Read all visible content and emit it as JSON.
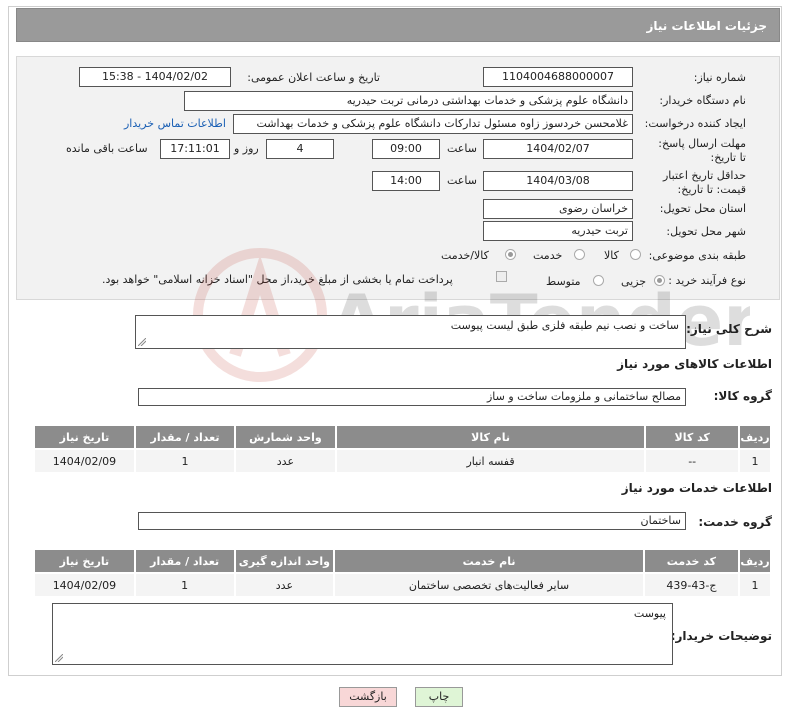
{
  "header": {
    "title": "جزئیات اطلاعات نیاز"
  },
  "form": {
    "need_number_label": "شماره نیاز:",
    "need_number": "1104004688000007",
    "announce_label": "تاریخ و ساعت اعلان عمومی:",
    "announce_value": "1404/02/02 - 15:38",
    "buyer_org_label": "نام دستگاه خریدار:",
    "buyer_org": "دانشگاه علوم پزشکی و خدمات بهداشتی درمانی تربت حیدریه",
    "creator_label": "ایجاد کننده درخواست:",
    "creator": "غلامحسن خردسوز زاوه مسئول تدارکات دانشگاه علوم پزشکی و خدمات بهداشت",
    "contact_link": "اطلاعات تماس خریدار",
    "deadline_label": "مهلت ارسال پاسخ: تا تاریخ:",
    "deadline_date": "1404/02/07",
    "time_label": "ساعت",
    "deadline_time": "09:00",
    "days_value": "4",
    "days_label": "روز و",
    "remaining_time": "17:11:01",
    "remaining_label": "ساعت باقی مانده",
    "validity_label": "حداقل تاریخ اعتبار قیمت: تا تاریخ:",
    "validity_date": "1404/03/08",
    "validity_time": "14:00",
    "province_label": "استان محل تحویل:",
    "province": "خراسان رضوی",
    "city_label": "شهر محل تحویل:",
    "city": "تربت حیدریه",
    "category_label": "طبقه بندی موضوعی:",
    "category_options": [
      "کالا",
      "خدمت",
      "کالا/خدمت"
    ],
    "process_label": "نوع فرآیند خرید :",
    "process_options": [
      "جزیی",
      "متوسط"
    ],
    "payment_note": "پرداخت تمام یا بخشی از مبلغ خرید،از محل \"اسناد خزانه اسلامی\" خواهد بود."
  },
  "description": {
    "label": "شرح کلی نیاز:",
    "value": "ساخت و نصب نیم طبقه فلزی طبق لیست پیوست"
  },
  "goods": {
    "section_title": "اطلاعات کالاهای مورد نیاز",
    "group_label": "گروه کالا:",
    "group_value": "مصالح ساختمانی و ملزومات ساخت و ساز",
    "headers": [
      "ردیف",
      "کد کالا",
      "نام کالا",
      "واحد شمارش",
      "تعداد / مقدار",
      "تاریخ نیاز"
    ],
    "rows": [
      [
        "1",
        "--",
        "قفسه انبار",
        "عدد",
        "1",
        "1404/02/09"
      ]
    ]
  },
  "services": {
    "section_title": "اطلاعات خدمات مورد نیاز",
    "group_label": "گروه خدمت:",
    "group_value": "ساختمان",
    "headers": [
      "ردیف",
      "کد خدمت",
      "نام خدمت",
      "واحد اندازه گیری",
      "تعداد / مقدار",
      "تاریخ نیاز"
    ],
    "rows": [
      [
        "1",
        "ج-43-439",
        "سایر فعالیت‌های تخصصی ساختمان",
        "عدد",
        "1",
        "1404/02/09"
      ]
    ]
  },
  "buyer_notes": {
    "label": "توضیحات خریدار:",
    "value": "پیوست"
  },
  "buttons": {
    "print": "چاپ",
    "back": "بازگشت"
  },
  "watermark_text": "AriaTender.neT",
  "colors": {
    "header_bg": "#9a9a9a",
    "table_header_bg": "#8c8c8c",
    "link": "#1a5fb4",
    "print_bg": "#dff5d6",
    "back_bg": "#f8d7d7"
  }
}
